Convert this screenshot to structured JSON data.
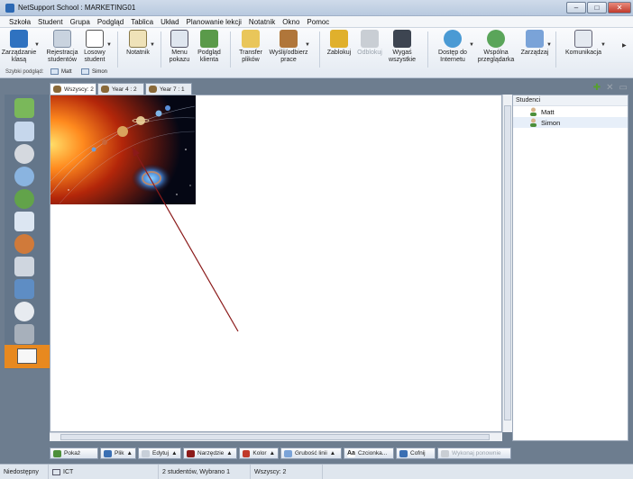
{
  "window": {
    "title": "NetSupport School : MARKETING01"
  },
  "menu": [
    "Szkoła",
    "Student",
    "Grupa",
    "Podgląd",
    "Tablica",
    "Układ",
    "Planowanie lekcji",
    "Notatnik",
    "Okno",
    "Pomoc"
  ],
  "toolbar": {
    "zarzadzanie": "Zarządzanie klasą",
    "rejestracja": "Rejestracja studentów",
    "losowy": "Losowy student",
    "notatnik": "Notatnik",
    "menu_pokazu": "Menu pokazu",
    "podglad_klienta": "Podgląd klienta",
    "transfer": "Transfer plików",
    "wyslij": "Wyślij/odbierz prace",
    "zablokuj": "Zablokuj",
    "odblokuj": "Odblokuj",
    "wygas": "Wygaś wszystkie",
    "dostep": "Dostęp do Internetu",
    "wspolna": "Wspólna przeglądarka",
    "zarzadzaj": "Zarządzaj",
    "komunikacja": "Komunikacja"
  },
  "quick_view": {
    "label": "Szybki podgląd:",
    "items": [
      "Matt",
      "Simon"
    ]
  },
  "tabs": [
    "Wszyscy: 2",
    "Year 4 : 2",
    "Year 7 : 1"
  ],
  "panel": {
    "title": "Studenci",
    "students": [
      "Matt",
      "Simon"
    ]
  },
  "bottom_toolbar": {
    "pokaz": "Pokaż",
    "plik": "Plik",
    "edytuj": "Edytuj",
    "narzedzie": "Narzędzie",
    "kolor": "Kolor",
    "grubosc": "Grubość linii",
    "czcionka": "Czcionka...",
    "cofnij": "Cofnij",
    "wykonaj": "Wykonaj ponownie"
  },
  "status": {
    "state": "Niedostępny",
    "ict": "ICT",
    "students": "2 studentów, Wybrano 1",
    "all": "Wszyscy: 2"
  },
  "colors": {
    "accent": "#e8891f",
    "annotation_line": "#8b1a1a"
  }
}
